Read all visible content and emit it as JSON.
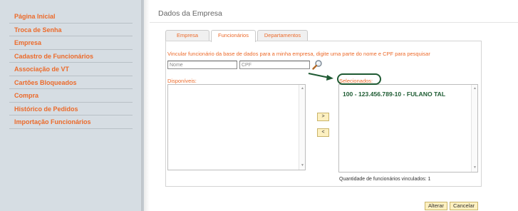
{
  "sidebar": {
    "items": [
      {
        "label": "Página Inicial"
      },
      {
        "label": "Troca de Senha"
      },
      {
        "label": "Empresa"
      },
      {
        "label": "Cadastro de Funcionários"
      },
      {
        "label": "Associação de VT"
      },
      {
        "label": "Cartões Bloqueados"
      },
      {
        "label": "Compra"
      },
      {
        "label": "Histórico de Pedidos"
      },
      {
        "label": "Importação Funcionários"
      }
    ]
  },
  "main": {
    "title": "Dados da Empresa",
    "tabs": [
      {
        "label": "Empresa",
        "active": false
      },
      {
        "label": "Funcionários",
        "active": true
      },
      {
        "label": "Departamentos",
        "active": false
      }
    ],
    "instructions": "Vincular funcionário da base de dados para a minha empresa, digite uma parte do nome e CPF para pesquisar",
    "search": {
      "name_placeholder": "Nome",
      "cpf_placeholder": "CPF",
      "icon": "search-icon"
    },
    "available": {
      "label": "Disponíveis:",
      "items": []
    },
    "selected": {
      "label": "Selecionados:",
      "items": [
        "100 - 123.456.789-10 - FULANO TAL"
      ]
    },
    "move_right_label": ">",
    "move_left_label": "<",
    "quantity_text": "Quantidade de funcionários vinculados: 1",
    "buttons": {
      "alterar": "Alterar",
      "cancelar": "Cancelar"
    }
  },
  "colors": {
    "accent": "#ec6a2a",
    "annotation": "#1f5a33",
    "sidebar_bg": "#d6dde3",
    "button_bg": "#fdf0c0"
  }
}
